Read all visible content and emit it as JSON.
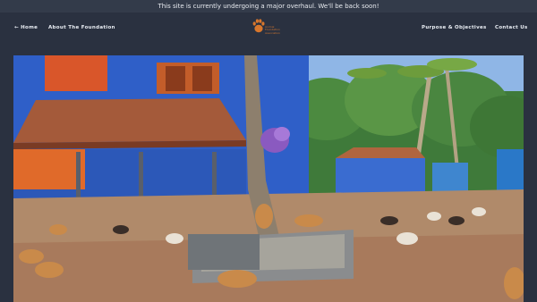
{
  "notice": {
    "text": "This site is currently undergoing a major overhaul. We'll be back soon!"
  },
  "nav": {
    "home": "← Home",
    "about": "About The Foundation",
    "purpose": "Purpose & Objectives",
    "contact": "Contact Us"
  },
  "logo": {
    "lines": [
      "Animal",
      "Foundation",
      "Association"
    ]
  },
  "colors": {
    "page_background": "#2a3140",
    "notice_background": "#333b4a",
    "nav_text": "#e9edf3",
    "logo_accent": "#d9772c"
  },
  "hero": {
    "icon": "photo-of-dogs-in-shelter-courtyard"
  }
}
